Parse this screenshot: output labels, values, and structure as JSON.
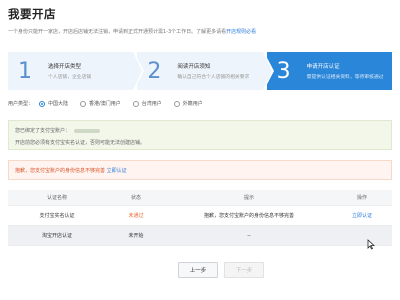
{
  "page": {
    "title": "我要开店",
    "intro_text": "一个身份只能开一家店，开店后店铺无法注销，申请到正式开通预计需1-3个工作日。了解更多请看",
    "intro_link": "开店规则必看"
  },
  "steps": [
    {
      "num": "1",
      "title": "选择开店类型",
      "sub": "个人店铺，企业店铺"
    },
    {
      "num": "2",
      "title": "阅读开店须知",
      "sub": "确认自己符合个人店铺的相关要求"
    },
    {
      "num": "3",
      "title": "申请开店认证",
      "sub": "需提供认证相关资料，等待审核通过"
    }
  ],
  "user_type": {
    "label": "用户类型：",
    "options": [
      "中国大陆",
      "香港/澳门用户",
      "台湾用户",
      "外籍用户"
    ],
    "selected": "中国大陆"
  },
  "notice_alipay": {
    "line1": "您已绑定了支付宝账户：",
    "line2": "开店前您必须有支付宝实名认证，否则可能无法创建店铺。"
  },
  "notice_warning": {
    "text": "抱歉，您支付宝账户的身份信息不够完善",
    "link": "立即认证"
  },
  "table": {
    "headers": [
      "认证名称",
      "状态",
      "提示",
      "操作"
    ],
    "rows": [
      {
        "name": "支付宝实名认证",
        "status": "未通过",
        "tip": "抱歉，您支付宝账户的身份信息不够完善",
        "action": "立即认证"
      },
      {
        "name": "淘宝开店认证",
        "status": "未开始",
        "tip": "--",
        "action": ""
      }
    ]
  },
  "buttons": {
    "prev": "上一步",
    "next": "下一步"
  },
  "colors": {
    "accent": "#2a86d8",
    "warning": "#d9542c",
    "link": "#2e7cd8"
  }
}
